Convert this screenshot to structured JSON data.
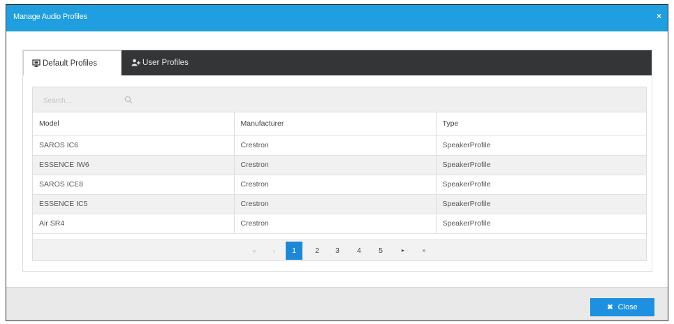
{
  "dialog": {
    "title": "Manage Audio Profiles",
    "close_glyph": "×",
    "accent_color": "#1f9ee0"
  },
  "tabs": [
    {
      "label": "Default Profiles",
      "icon": "monitor-icon",
      "active": true
    },
    {
      "label": "User Profiles",
      "icon": "users-icon",
      "active": false
    }
  ],
  "search": {
    "placeholder": "Search...",
    "icon": "search-icon"
  },
  "table": {
    "columns": [
      "Model",
      "Manufacturer",
      "Type"
    ],
    "rows": [
      [
        "SAROS IC6",
        "Crestron",
        "SpeakerProfile"
      ],
      [
        "ESSENCE IW6",
        "Crestron",
        "SpeakerProfile"
      ],
      [
        "SAROS ICE8",
        "Crestron",
        "SpeakerProfile"
      ],
      [
        "ESSENCE IC5",
        "Crestron",
        "SpeakerProfile"
      ],
      [
        "Air SR4",
        "Crestron",
        "SpeakerProfile"
      ]
    ]
  },
  "pagination": {
    "first": "«",
    "prev": "‹",
    "pages": [
      "1",
      "2",
      "3",
      "4",
      "5"
    ],
    "current": "1",
    "next": "▸",
    "last": "»"
  },
  "footer": {
    "close_label": "Close",
    "close_glyph": "✖"
  }
}
